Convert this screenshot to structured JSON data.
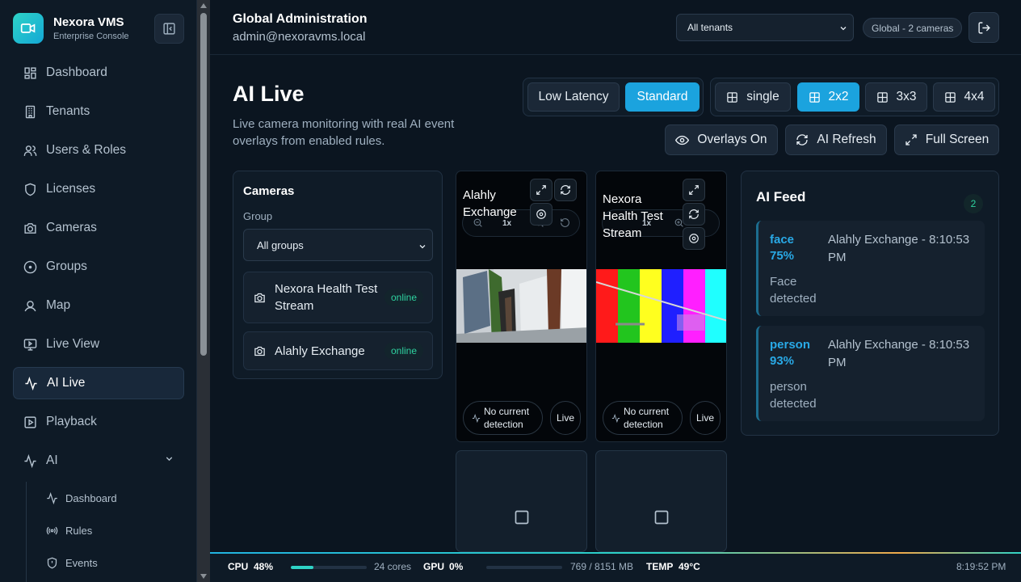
{
  "brand": {
    "name": "Nexora VMS",
    "subtitle": "Enterprise Console"
  },
  "sidebar": {
    "items": [
      {
        "label": "Dashboard",
        "icon": "dashboard-grid-icon"
      },
      {
        "label": "Tenants",
        "icon": "building-icon"
      },
      {
        "label": "Users & Roles",
        "icon": "users-icon"
      },
      {
        "label": "Licenses",
        "icon": "shield-icon"
      },
      {
        "label": "Cameras",
        "icon": "camera-icon"
      },
      {
        "label": "Groups",
        "icon": "circle-dot-icon"
      },
      {
        "label": "Map",
        "icon": "map-pin-icon"
      },
      {
        "label": "Live View",
        "icon": "monitor-icon"
      },
      {
        "label": "AI Live",
        "icon": "activity-icon",
        "active": true
      },
      {
        "label": "Playback",
        "icon": "play-square-icon"
      },
      {
        "label": "AI",
        "icon": "activity-icon",
        "expanded": true
      }
    ],
    "ai_sub": [
      {
        "label": "Dashboard",
        "icon": "activity-icon"
      },
      {
        "label": "Rules",
        "icon": "broadcast-icon"
      },
      {
        "label": "Events",
        "icon": "shield-icon"
      }
    ]
  },
  "header": {
    "title": "Global Administration",
    "user": "admin@nexoravms.local",
    "tenant_select": "All tenants",
    "scope_badge": "Global - 2 cameras"
  },
  "page": {
    "title": "AI Live",
    "description": "Live camera monitoring with real AI event overlays from enabled rules."
  },
  "toolbar": {
    "latency": {
      "low": "Low Latency",
      "standard": "Standard",
      "selected": "Standard"
    },
    "layouts": {
      "single": "single",
      "g2": "2x2",
      "g3": "3x3",
      "g4": "4x4",
      "selected": "2x2"
    },
    "overlays": "Overlays On",
    "refresh": "AI Refresh",
    "fullscreen": "Full Screen"
  },
  "cameras_panel": {
    "title": "Cameras",
    "group_label": "Group",
    "group_value": "All groups",
    "items": [
      {
        "name": "Nexora Health Test Stream",
        "status": "online"
      },
      {
        "name": "Alahly Exchange",
        "status": "online"
      }
    ]
  },
  "tiles": [
    {
      "name": "Alahly Exchange",
      "zoom": "1x",
      "detection": "No current detection",
      "live": "Live"
    },
    {
      "name": "Nexora Health Test Stream",
      "zoom": "1x",
      "detection": "No current detection",
      "live": "Live"
    }
  ],
  "ai_feed": {
    "title": "AI Feed",
    "count": "2",
    "events": [
      {
        "label": "face",
        "confidence": "75%",
        "source": "Alahly Exchange - 8:10:53 PM",
        "description": "Face detected"
      },
      {
        "label": "person",
        "confidence": "93%",
        "source": "Alahly Exchange - 8:10:53 PM",
        "description": "person detected"
      }
    ]
  },
  "status": {
    "cpu_label": "CPU",
    "cpu_value": "48%",
    "cpu_level": 0.3,
    "cores": "24 cores",
    "gpu_label": "GPU",
    "gpu_value": "0%",
    "gpu_level": 0,
    "gpu_mem": "769 / 8151 MB",
    "temp_label": "TEMP",
    "temp_value": "49°C",
    "time": "8:19:52 PM"
  },
  "colors": {
    "accent": "#1ba3de",
    "teal": "#2ed3c6",
    "online": "#2ed3a0",
    "background": "#0b1520"
  }
}
